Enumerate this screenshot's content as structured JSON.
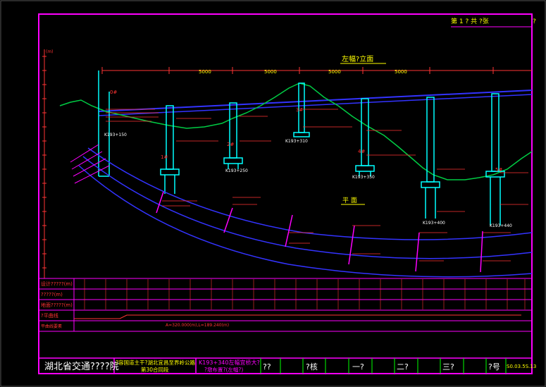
{
  "sheet": {
    "label": "第 1 ? 共 ?张",
    "corner_mark": "?"
  },
  "elevation": {
    "title": "左幅?立面",
    "span_labels": [
      "5000",
      "5000",
      "5000",
      "5000"
    ],
    "elev_marker": "(m)",
    "pier_labels": [
      "0#",
      "1#",
      "2#",
      "3#",
      "4#",
      "5#"
    ],
    "stations": [
      "K193+150",
      "K193+250",
      "K193+310",
      "K193+350",
      "K193+400",
      "K193+440"
    ]
  },
  "plan": {
    "title": "平  面",
    "curve_note": "A=320.000(m),L=189.240(m)"
  },
  "table": {
    "rows": [
      "设计?????(m)",
      "?????(m)",
      "地面?????(m)",
      "?平曲线",
      "平曲线要素"
    ]
  },
  "title_block": {
    "org": "湖北省交通????院",
    "project_line1": "?容国道主干?湖北宜昌至界岭公路",
    "project_line2": "第30合同段",
    "bridge_line1": "K193+340左幅宜桥大?",
    "bridge_line2": "?墩布置?(左幅?)",
    "cells": [
      "??",
      "?核",
      "一?",
      "二?",
      "三?",
      "?号"
    ],
    "drawing_no": "S0.03.5S.13"
  },
  "colors": {
    "frame": "#ff00ff",
    "deck": "#3333ff",
    "ground": "#00cc44",
    "label": "#ffff00",
    "annot": "#ff3333",
    "pier": "#00ffff",
    "cell_line": "#00ff00"
  }
}
